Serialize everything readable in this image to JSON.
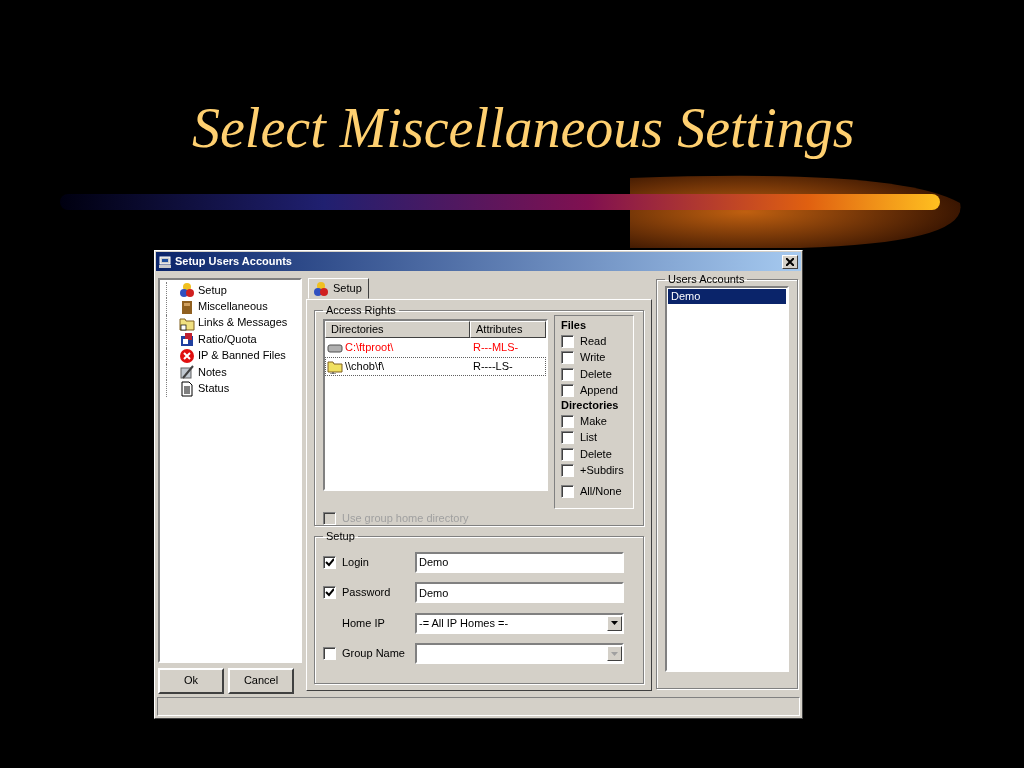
{
  "slide": {
    "title": "Select Miscellaneous Settings"
  },
  "window": {
    "title": "Setup Users Accounts"
  },
  "tree": {
    "items": [
      {
        "label": "Setup",
        "kind": "shapes"
      },
      {
        "label": "Miscellaneous",
        "kind": "book"
      },
      {
        "label": "Links & Messages",
        "kind": "folder"
      },
      {
        "label": "Ratio/Quota",
        "kind": "package"
      },
      {
        "label": "IP & Banned Files",
        "kind": "stop"
      },
      {
        "label": "Notes",
        "kind": "pen"
      },
      {
        "label": "Status",
        "kind": "document"
      }
    ]
  },
  "buttons": [
    {
      "label": "Ok"
    },
    {
      "label": "Cancel"
    }
  ],
  "tab": {
    "label": "Setup",
    "selected": true
  },
  "access_rights": {
    "title": "Access Rights",
    "columns": [
      "Directories",
      "Attributes"
    ],
    "rows": [
      {
        "path": "C:\\ftproot\\",
        "attributes": "R---MLS-",
        "kind": "drive",
        "color": "#ff0000",
        "focused": false
      },
      {
        "path": "\\\\chob\\f\\",
        "attributes": "R----LS-",
        "kind": "network-folder",
        "color": "#000000",
        "focused": true
      }
    ],
    "use_group_home": {
      "label": "Use group home directory",
      "checked": false,
      "disabled": true
    },
    "files": {
      "title": "Files",
      "options": [
        {
          "label": "Read",
          "checked": false
        },
        {
          "label": "Write",
          "checked": false
        },
        {
          "label": "Delete",
          "checked": false
        },
        {
          "label": "Append",
          "checked": false
        }
      ]
    },
    "directories": {
      "title": "Directories",
      "options": [
        {
          "label": "Make",
          "checked": false
        },
        {
          "label": "List",
          "checked": false
        },
        {
          "label": "Delete",
          "checked": false
        },
        {
          "label": "+Subdirs",
          "checked": false
        }
      ]
    },
    "all_none": {
      "label": "All/None",
      "checked": false
    }
  },
  "setup": {
    "title": "Setup",
    "fields": [
      {
        "kind": "check-text",
        "label": "Login",
        "checked": true,
        "value": "Demo"
      },
      {
        "kind": "check-text",
        "label": "Password",
        "checked": true,
        "value": "Demo"
      },
      {
        "kind": "select",
        "label": "Home IP",
        "value": "-= All IP Homes =-"
      },
      {
        "kind": "check-select",
        "label": "Group Name",
        "checked": false
      }
    ]
  },
  "users": {
    "title": "Users Accounts",
    "items": [
      {
        "label": "Demo",
        "selected": true
      }
    ]
  }
}
